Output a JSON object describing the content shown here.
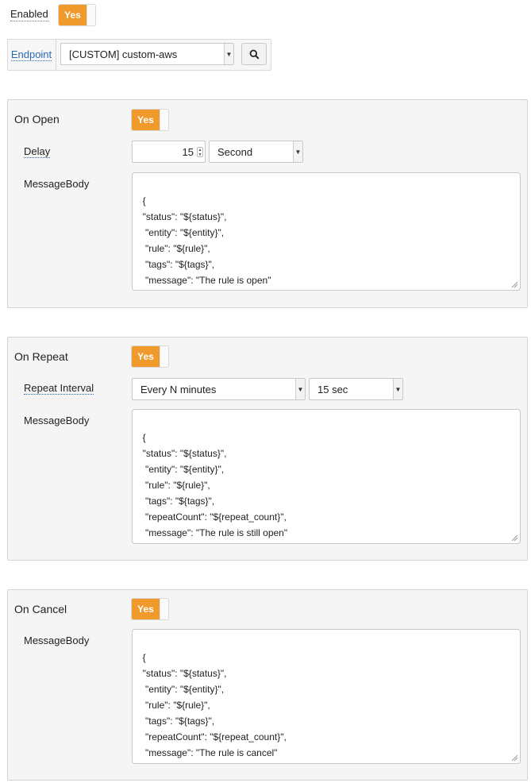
{
  "enabled": {
    "label": "Enabled",
    "toggle": "Yes"
  },
  "endpoint": {
    "label": "Endpoint",
    "value": "[CUSTOM] custom-aws",
    "search_icon": "search-icon"
  },
  "on_open": {
    "title": "On Open",
    "toggle": "Yes",
    "delay_label": "Delay",
    "delay_value": "15",
    "delay_unit": "Second",
    "body_label": "MessageBody",
    "body": "{\n  \"status\": \"${status}\",\n   \"entity\": \"${entity}\",\n   \"rule\": \"${rule}\",\n   \"tags\": \"${tags}\",\n   \"message\": \"The rule is open\"\n}"
  },
  "on_repeat": {
    "title": "On Repeat",
    "toggle": "Yes",
    "interval_label": "Repeat Interval",
    "interval_mode": "Every N minutes",
    "interval_value": "15 sec",
    "body_label": "MessageBody",
    "body": "{\n  \"status\": \"${status}\",\n   \"entity\": \"${entity}\",\n   \"rule\": \"${rule}\",\n   \"tags\": \"${tags}\",\n   \"repeatCount\": \"${repeat_count}\",\n   \"message\": \"The rule is still open\"\n}"
  },
  "on_cancel": {
    "title": "On Cancel",
    "toggle": "Yes",
    "body_label": "MessageBody",
    "body": "{\n  \"status\": \"${status}\",\n   \"entity\": \"${entity}\",\n   \"rule\": \"${rule}\",\n   \"tags\": \"${tags}\",\n   \"repeatCount\": \"${repeat_count}\",\n   \"message\": \"The rule is cancel\"\n}"
  },
  "colors": {
    "accent": "#f09a2c",
    "link": "#2a6ab3",
    "panel": "#f5f5f5"
  }
}
